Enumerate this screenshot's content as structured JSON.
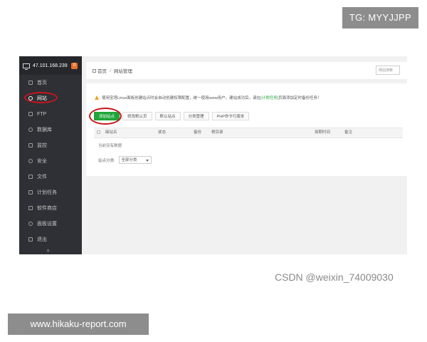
{
  "overlay": {
    "tg_badge": "TG: MYYJJPP",
    "watermark": "CSDN @weixin_74009030",
    "site_banner": "www.hikaku-report.com"
  },
  "sidebar": {
    "server_ip": "47.101.168.239",
    "badge": "0",
    "items": [
      {
        "label": "首页",
        "icon": "home-icon"
      },
      {
        "label": "网站",
        "icon": "globe-icon"
      },
      {
        "label": "FTP",
        "icon": "ftp-icon"
      },
      {
        "label": "数据库",
        "icon": "database-icon"
      },
      {
        "label": "监控",
        "icon": "monitor-icon"
      },
      {
        "label": "安全",
        "icon": "shield-icon"
      },
      {
        "label": "文件",
        "icon": "folder-icon"
      },
      {
        "label": "计划任务",
        "icon": "calendar-icon"
      },
      {
        "label": "软件商店",
        "icon": "store-icon"
      },
      {
        "label": "面板设置",
        "icon": "gear-icon"
      },
      {
        "label": "退出",
        "icon": "logout-icon"
      }
    ],
    "plus": "+"
  },
  "topbar": {
    "breadcrumb_home": "首页",
    "breadcrumb_sep": "/",
    "breadcrumb_current": "网站管理",
    "search_placeholder": "网站搜索"
  },
  "notice": {
    "text_before": "使用宝塔Linux面板创建站点时会自动创建权限配置，统一使用www用户。建站成功后，请在",
    "link": "[计划任务]",
    "text_after": "页面添加定时备份任务！"
  },
  "toolbar": {
    "add_site": "添加站点",
    "modify_default_page": "修改默认页",
    "default_site": "默认站点",
    "category_manage": "分类管理",
    "php_cli_version": "PHP命令行版本"
  },
  "table": {
    "headers": [
      "网站名",
      "状态",
      "备份",
      "根目录",
      "到期时间",
      "备注"
    ],
    "sort_glyph": "▲",
    "empty_text": "当前没有数据"
  },
  "footer": {
    "category_label": "站点分类:",
    "category_value": "全部分类"
  }
}
